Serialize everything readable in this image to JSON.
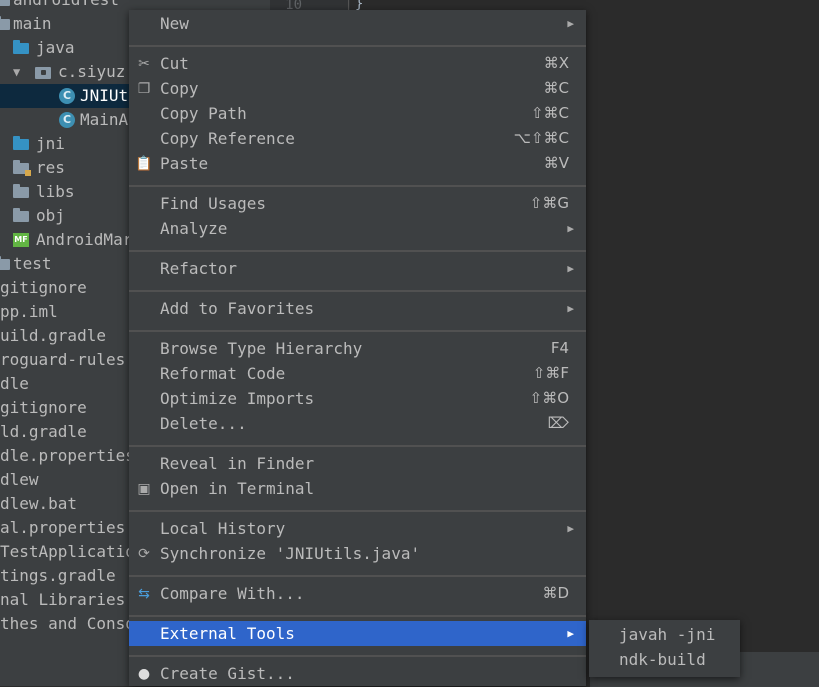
{
  "editor": {
    "line_number": "10",
    "brace": "}"
  },
  "tree": {
    "items": [
      {
        "label": "androidTest",
        "icon": "folder-icon"
      },
      {
        "label": "main",
        "icon": "folder-icon"
      },
      {
        "label": "java",
        "icon": "folder-blue-icon"
      },
      {
        "label": "c.siyuz",
        "icon": "package-icon"
      },
      {
        "label": "JNIUt",
        "icon": "class-icon",
        "selected": true
      },
      {
        "label": "MainA",
        "icon": "class-icon"
      },
      {
        "label": "jni",
        "icon": "folder-blue-icon"
      },
      {
        "label": "res",
        "icon": "resources-folder-icon"
      },
      {
        "label": "libs",
        "icon": "folder-icon"
      },
      {
        "label": "obj",
        "icon": "folder-icon"
      },
      {
        "label": "AndroidMar",
        "icon": "manifest-icon"
      },
      {
        "label": "test",
        "icon": "folder-icon"
      },
      {
        "label": "gitignore"
      },
      {
        "label": "pp.iml"
      },
      {
        "label": "uild.gradle"
      },
      {
        "label": "roguard-rules"
      },
      {
        "label": "dle"
      },
      {
        "label": "gitignore"
      },
      {
        "label": "ld.gradle"
      },
      {
        "label": "dle.properties"
      },
      {
        "label": "dlew"
      },
      {
        "label": "dlew.bat"
      },
      {
        "label": "al.properties"
      },
      {
        "label": "TestApplicatio"
      },
      {
        "label": "tings.gradle"
      },
      {
        "label": "nal Libraries"
      },
      {
        "label": "thes and Conso"
      }
    ]
  },
  "menu": {
    "items": [
      {
        "label": "New",
        "submenu": true
      },
      {
        "label": "Cut",
        "shortcut": "⌘X",
        "icon": "scissors-icon"
      },
      {
        "label": "Copy",
        "shortcut": "⌘C",
        "icon": "copy-icon"
      },
      {
        "label": "Copy Path",
        "shortcut": "⇧⌘C"
      },
      {
        "label": "Copy Reference",
        "shortcut": "⌥⇧⌘C"
      },
      {
        "label": "Paste",
        "shortcut": "⌘V",
        "icon": "clipboard-icon"
      },
      {
        "label": "Find Usages",
        "shortcut": "⇧⌘G"
      },
      {
        "label": "Analyze",
        "submenu": true
      },
      {
        "label": "Refactor",
        "submenu": true
      },
      {
        "label": "Add to Favorites",
        "submenu": true
      },
      {
        "label": "Browse Type Hierarchy",
        "shortcut": "F4"
      },
      {
        "label": "Reformat Code",
        "shortcut": "⇧⌘F"
      },
      {
        "label": "Optimize Imports",
        "shortcut": "⇧⌘O"
      },
      {
        "label": "Delete...",
        "shortcut": "⌦"
      },
      {
        "label": "Reveal in Finder"
      },
      {
        "label": "Open in Terminal",
        "icon": "terminal-icon"
      },
      {
        "label": "Local History",
        "submenu": true
      },
      {
        "label": "Synchronize 'JNIUtils.java'",
        "icon": "sync-icon"
      },
      {
        "label": "Compare With...",
        "shortcut": "⌘D",
        "icon": "compare-icon"
      },
      {
        "label": "External Tools",
        "submenu": true,
        "active": true
      },
      {
        "label": "Create Gist...",
        "icon": "github-icon"
      }
    ]
  },
  "submenu": {
    "items": [
      {
        "label": "javah -jni"
      },
      {
        "label": "ndk-build"
      }
    ]
  }
}
